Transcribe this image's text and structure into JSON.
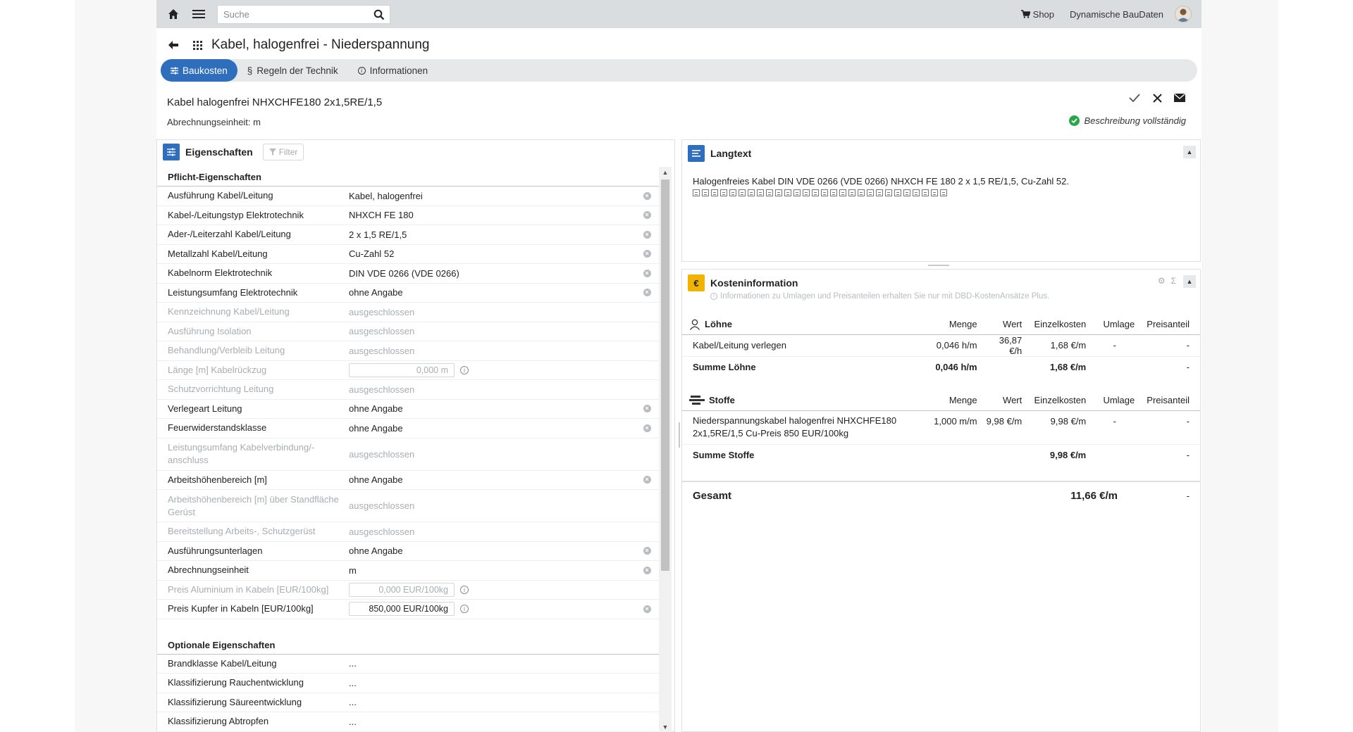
{
  "topbar": {
    "search_placeholder": "Suche",
    "shop_label": "Shop",
    "brand_label": "Dynamische BauDaten"
  },
  "page": {
    "title": "Kabel, halogenfrei - Niederspannung"
  },
  "tabs": [
    {
      "label": "Baukosten",
      "active": true
    },
    {
      "label": "Regeln der Technik",
      "active": false
    },
    {
      "label": "Informationen",
      "active": false
    }
  ],
  "item": {
    "title": "Kabel halogenfrei NHXCHFE180 2x1,5RE/1,5",
    "unit_label": "Abrechnungseinheit: m",
    "status": "Beschreibung vollständig"
  },
  "properties": {
    "panel_title": "Eigenschaften",
    "filter_label": "Filter",
    "required_heading": "Pflicht-Eigenschaften",
    "optional_heading": "Optionale Eigenschaften",
    "required": [
      {
        "name": "Ausführung Kabel/Leitung",
        "value": "Kabel, halogenfrei"
      },
      {
        "name": "Kabel-/Leitungstyp Elektrotechnik",
        "value": "NHXCH FE 180"
      },
      {
        "name": "Ader-/Leiterzahl Kabel/Leitung",
        "value": "2 x 1,5 RE/1,5"
      },
      {
        "name": "Metallzahl Kabel/Leitung",
        "value": "Cu-Zahl 52"
      },
      {
        "name": "Kabelnorm Elektrotechnik",
        "value": "DIN VDE 0266 (VDE 0266)"
      },
      {
        "name": "Leistungsumfang Elektrotechnik",
        "value": "ohne Angabe"
      },
      {
        "name": "Kennzeichnung Kabel/Leitung",
        "value": "ausgeschlossen"
      },
      {
        "name": "Ausführung Isolation",
        "value": "ausgeschlossen"
      },
      {
        "name": "Behandlung/Verbleib Leitung",
        "value": "ausgeschlossen"
      },
      {
        "name": "Länge [m] Kabelrückzug",
        "value": "0,000 m"
      },
      {
        "name": "Schutzvorrichtung Leitung",
        "value": "ausgeschlossen"
      },
      {
        "name": "Verlegeart Leitung",
        "value": "ohne Angabe"
      },
      {
        "name": "Feuerwiderstandsklasse",
        "value": "ohne Angabe"
      },
      {
        "name": "Leistungsumfang Kabelverbindung/-anschluss",
        "value": "ausgeschlossen"
      },
      {
        "name": "Arbeitshöhenbereich [m]",
        "value": "ohne Angabe"
      },
      {
        "name": "Arbeitshöhenbereich [m] über Standfläche Gerüst",
        "value": "ausgeschlossen"
      },
      {
        "name": "Bereitstellung Arbeits-, Schutzgerüst",
        "value": "ausgeschlossen"
      },
      {
        "name": "Ausführungsunterlagen",
        "value": "ohne Angabe"
      },
      {
        "name": "Abrechnungseinheit",
        "value": "m"
      },
      {
        "name": "Preis Aluminium in Kabeln [EUR/100kg]",
        "value": "0,000 EUR/100kg"
      },
      {
        "name": "Preis Kupfer in Kabeln [EUR/100kg]",
        "value": "850,000 EUR/100kg"
      }
    ],
    "optional": [
      {
        "name": "Brandklasse Kabel/Leitung",
        "value": "..."
      },
      {
        "name": "Klassifizierung Rauchentwicklung",
        "value": "..."
      },
      {
        "name": "Klassifizierung Säureentwicklung",
        "value": "..."
      },
      {
        "name": "Klassifizierung Abtropfen",
        "value": "..."
      }
    ]
  },
  "langtext": {
    "panel_title": "Langtext",
    "text": "Halogenfreies Kabel DIN VDE 0266 (VDE 0266) NHXCH FE 180 2 x 1,5 RE/1,5, Cu-Zahl 52."
  },
  "cost": {
    "panel_title": "Kosteninformation",
    "note": "Informationen zu Umlagen und Preisanteilen erhalten Sie nur mit DBD-KostenAnsätze Plus.",
    "columns": {
      "menge": "Menge",
      "wert": "Wert",
      "einzelkosten": "Einzelkosten",
      "umlage": "Umlage",
      "preisanteil": "Preisanteil"
    },
    "loehne": {
      "title": "Löhne",
      "rows": [
        {
          "name": "Kabel/Leitung verlegen",
          "menge": "0,046 h/m",
          "wert": "36,87 €/h",
          "einzelkosten": "1,68 €/m",
          "umlage": "-",
          "preisanteil": "-"
        }
      ],
      "sum": {
        "name": "Summe Löhne",
        "menge": "0,046 h/m",
        "einzelkosten": "1,68 €/m",
        "preisanteil": "-"
      }
    },
    "stoffe": {
      "title": "Stoffe",
      "rows": [
        {
          "name": "Niederspannungskabel halogenfrei NHXCHFE180 2x1,5RE/1,5 Cu-Preis 850 EUR/100kg",
          "menge": "1,000 m/m",
          "wert": "9,98 €/m",
          "einzelkosten": "9,98 €/m",
          "umlage": "-",
          "preisanteil": "-"
        }
      ],
      "sum": {
        "name": "Summe Stoffe",
        "einzelkosten": "9,98 €/m",
        "preisanteil": "-"
      }
    },
    "total": {
      "label": "Gesamt",
      "value": "11,66 €/m",
      "preisanteil": "-"
    }
  },
  "colors": {
    "accent": "#2f6ebd",
    "cost_icon": "#f0b400",
    "ok_green": "#2aa54a",
    "topbar": "#dadde0"
  }
}
